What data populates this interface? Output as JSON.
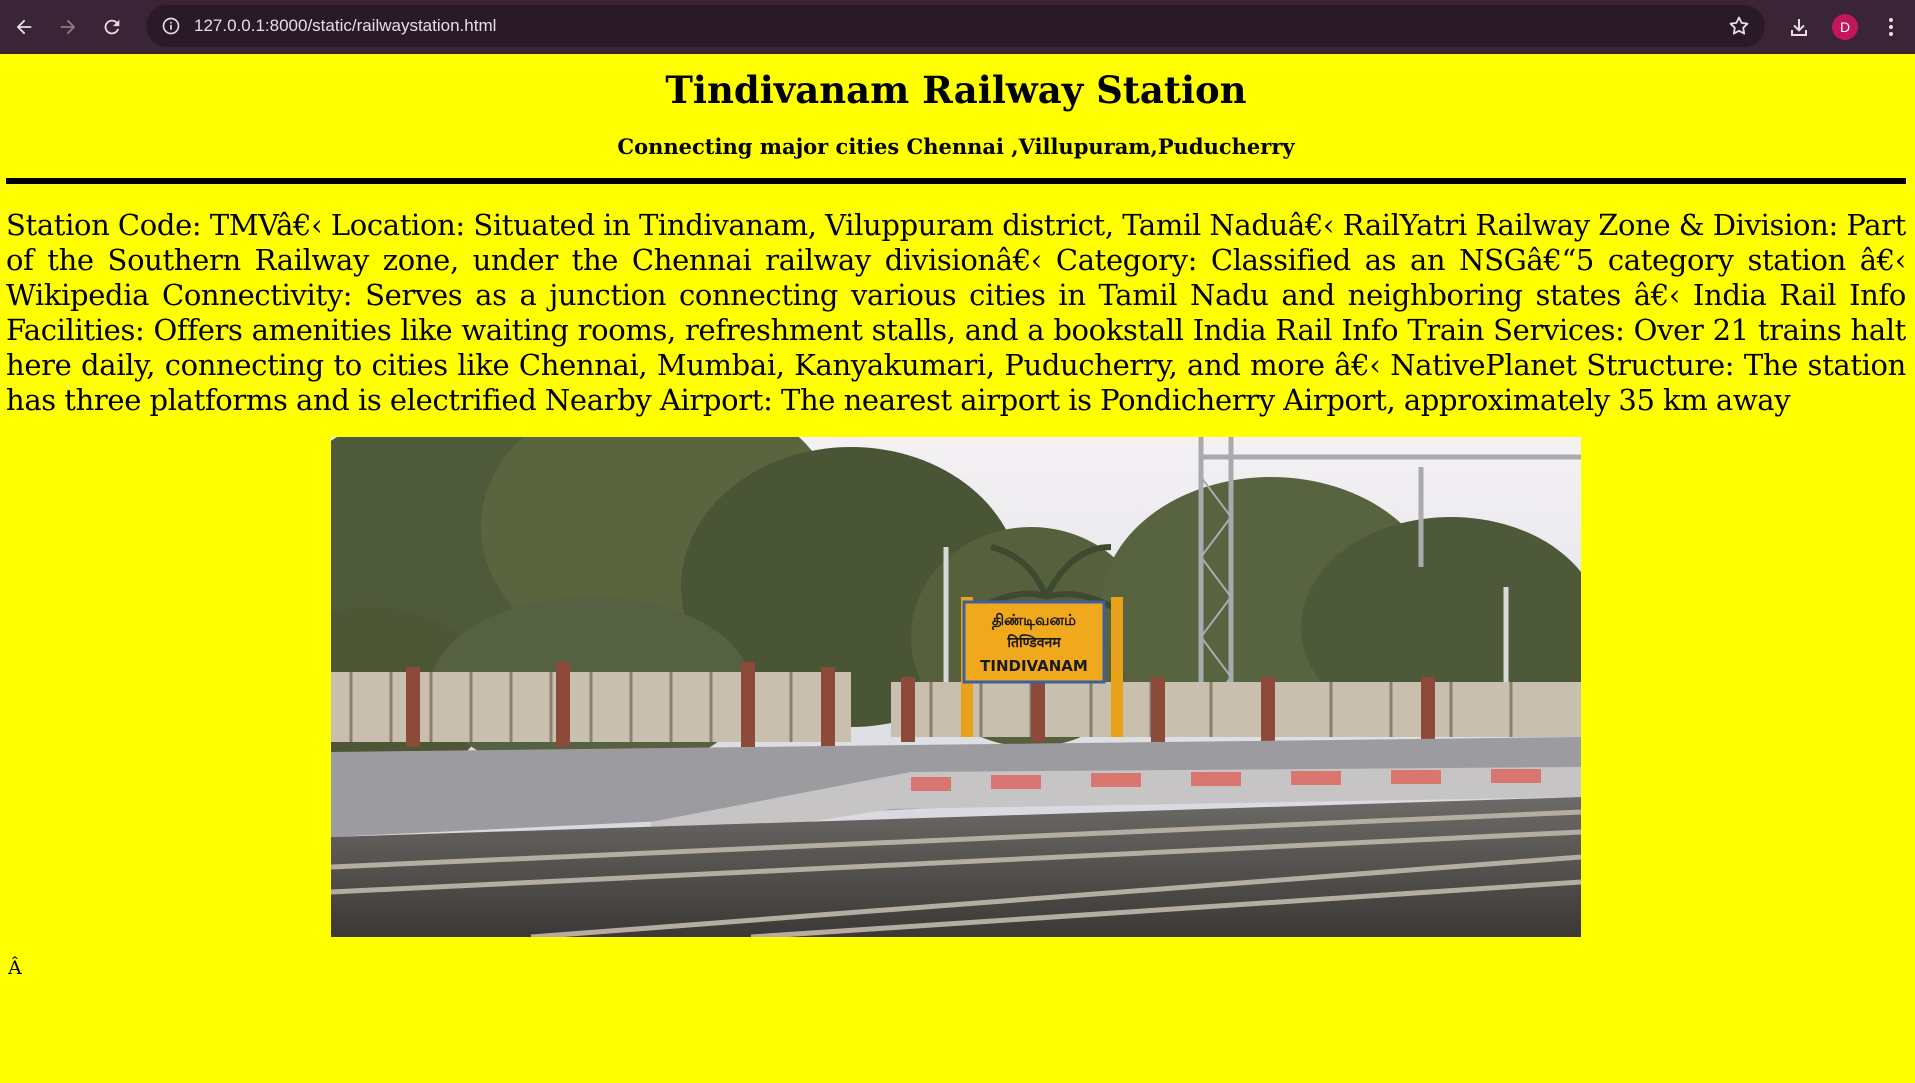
{
  "browser": {
    "url": "127.0.0.1:8000/static/railwaystation.html",
    "profile_initial": "D"
  },
  "page": {
    "title": "Tindivanam Railway Station",
    "subtitle": "Connecting major cities Chennai ,Villupuram,Puducherry",
    "body": "Station Code: TMVâ€‹ Location: Situated in Tindivanam, Viluppuram district, Tamil Naduâ€‹ RailYatri Railway Zone & Division: Part of the Southern Railway zone, under the Chennai railway divisionâ€‹ Category: Classified as an NSGâ€“5 category station â€‹ Wikipedia Connectivity: Serves as a junction connecting various cities in Tamil Nadu and neighboring states â€‹ India Rail Info Facilities: Offers amenities like waiting rooms, refreshment stalls, and a bookstall India Rail Info Train Services: Over 21 trains halt here daily, connecting to cities like Chennai, Mumbai, Kanyakumari, Puducherry, and more â€‹ NativePlanet Structure: The station has three platforms and is electrified Nearby Airport: The nearest airport is Pondicherry Airport, approximately 35 km away",
    "stray_char": "Â",
    "photo_sign": {
      "line1": "திண்டிவனம்",
      "line2": "तिण्डिवनम",
      "line3": "TINDIVANAM"
    }
  },
  "colors": {
    "page_background": "#ffff00",
    "chrome_background": "#3a2436",
    "avatar": "#c2185b"
  }
}
